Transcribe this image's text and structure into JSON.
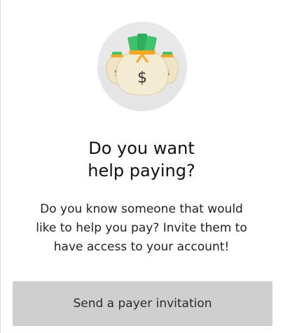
{
  "illustration": {
    "icon": "money-bags-icon",
    "bag_symbol": "$",
    "accent_color": "#3cc36b",
    "tie_color": "#f5a623",
    "bag_color": "#efe4c4",
    "circle_color": "#e6e6e6"
  },
  "heading": {
    "line1": "Do you want",
    "line2": "help paying?"
  },
  "description": {
    "line1": "Do you know someone that would",
    "line2": "like to help you pay? Invite them to",
    "line3": "have access to your account!"
  },
  "actions": {
    "invite_label": "Send a payer invitation",
    "button_color": "#cfcfcf"
  }
}
